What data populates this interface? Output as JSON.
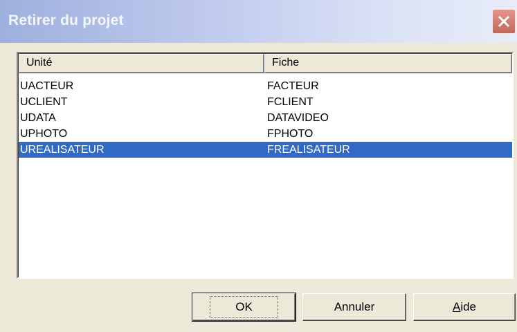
{
  "window": {
    "title": "Retirer du projet"
  },
  "list": {
    "columns": [
      "Unité",
      "Fiche"
    ],
    "rows": [
      {
        "unite": "UACTEUR",
        "fiche": "FACTEUR"
      },
      {
        "unite": "UCLIENT",
        "fiche": "FCLIENT"
      },
      {
        "unite": "UDATA",
        "fiche": "DATAVIDEO"
      },
      {
        "unite": "UPHOTO",
        "fiche": "FPHOTO"
      },
      {
        "unite": "UREALISATEUR",
        "fiche": "FREALISATEUR"
      }
    ],
    "selected_row": "UREALISATEUR",
    "selection_color": "#316ac5"
  },
  "buttons": {
    "ok_label": "OK",
    "cancel_label": "Annuler",
    "help_label": "Aide"
  },
  "colors": {
    "dialog_bg": "#ece9d8",
    "close_button": "#d17a6e"
  },
  "icons": {
    "close": "close-icon"
  }
}
